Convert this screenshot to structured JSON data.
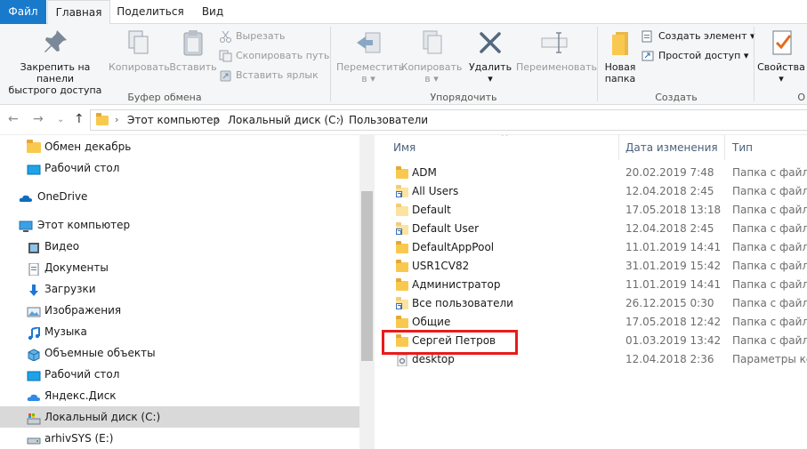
{
  "tabs": {
    "file": "Файл",
    "home": "Главная",
    "share": "Поделиться",
    "view": "Вид"
  },
  "ribbon": {
    "clipboard": {
      "pin_line1": "Закрепить на панели",
      "pin_line2": "быстрого доступа",
      "copy": "Копировать",
      "paste": "Вставить",
      "cut": "Вырезать",
      "copy_path": "Скопировать путь",
      "paste_shortcut": "Вставить ярлык",
      "label": "Буфер обмена"
    },
    "organize": {
      "move_line1": "Переместить",
      "move_line2": "в",
      "copy_line1": "Копировать",
      "copy_line2": "в",
      "delete": "Удалить",
      "rename": "Переименовать",
      "label": "Упорядочить"
    },
    "create": {
      "new_folder_line1": "Новая",
      "new_folder_line2": "папка",
      "new_item": "Создать элемент",
      "easy_access": "Простой доступ",
      "label": "Создать"
    },
    "open": {
      "properties": "Свойства",
      "label_partial": "О"
    }
  },
  "address": {
    "crumbs": [
      "Этот компьютер",
      "Локальный диск (C:)",
      "Пользователи"
    ]
  },
  "nav_pane": {
    "items": [
      {
        "label": "Обмен декабрь",
        "icon": "folder-icon"
      },
      {
        "label": "Рабочий стол",
        "icon": "desktop-icon"
      },
      {
        "label": "OneDrive",
        "icon": "onedrive-icon"
      },
      {
        "label": "Этот компьютер",
        "icon": "computer-icon"
      },
      {
        "label": "Видео",
        "icon": "video-icon"
      },
      {
        "label": "Документы",
        "icon": "documents-icon"
      },
      {
        "label": "Загрузки",
        "icon": "downloads-icon"
      },
      {
        "label": "Изображения",
        "icon": "pictures-icon"
      },
      {
        "label": "Музыка",
        "icon": "music-icon"
      },
      {
        "label": "Объемные объекты",
        "icon": "3d-objects-icon"
      },
      {
        "label": "Рабочий стол",
        "icon": "desktop-icon"
      },
      {
        "label": "Яндекс.Диск",
        "icon": "yandex-disk-icon"
      },
      {
        "label": "Локальный диск (C:)",
        "icon": "drive-c-icon",
        "selected": true
      },
      {
        "label": "arhivSYS (E:)",
        "icon": "drive-icon"
      }
    ]
  },
  "file_list": {
    "columns": {
      "name": "Имя",
      "date": "Дата изменения",
      "type": "Тип"
    },
    "rows": [
      {
        "name": "ADM",
        "date": "20.02.2019 7:48",
        "type": "Папка с файлами",
        "icon": "folder-icon"
      },
      {
        "name": "All Users",
        "date": "12.04.2018 2:45",
        "type": "Папка с файлами",
        "icon": "folder-shortcut-icon"
      },
      {
        "name": "Default",
        "date": "17.05.2018 13:18",
        "type": "Папка с файлами",
        "icon": "folder-hidden-icon"
      },
      {
        "name": "Default User",
        "date": "12.04.2018 2:45",
        "type": "Папка с файлами",
        "icon": "folder-shortcut-icon"
      },
      {
        "name": "DefaultAppPool",
        "date": "11.01.2019 14:41",
        "type": "Папка с файлами",
        "icon": "folder-icon"
      },
      {
        "name": "USR1CV82",
        "date": "31.01.2019 15:42",
        "type": "Папка с файлами",
        "icon": "folder-icon"
      },
      {
        "name": "Администратор",
        "date": "11.01.2019 14:41",
        "type": "Папка с файлами",
        "icon": "folder-icon"
      },
      {
        "name": "Все пользователи",
        "date": "26.12.2015 0:30",
        "type": "Папка с файлами",
        "icon": "folder-shortcut-icon"
      },
      {
        "name": "Общие",
        "date": "17.05.2018 12:42",
        "type": "Папка с файлами",
        "icon": "folder-icon"
      },
      {
        "name": "Сергей Петров",
        "date": "01.03.2019 13:42",
        "type": "Папка с файлами",
        "icon": "folder-icon",
        "highlighted": true
      },
      {
        "name": "desktop",
        "date": "12.04.2018 2:36",
        "type": "Параметры конфигурации",
        "icon": "settings-file-icon"
      }
    ]
  },
  "colors": {
    "file_tab": "#1979ca",
    "folder": "#f9c94f",
    "highlight": "#e81b1b",
    "selected_nav": "#d9d9d9"
  }
}
